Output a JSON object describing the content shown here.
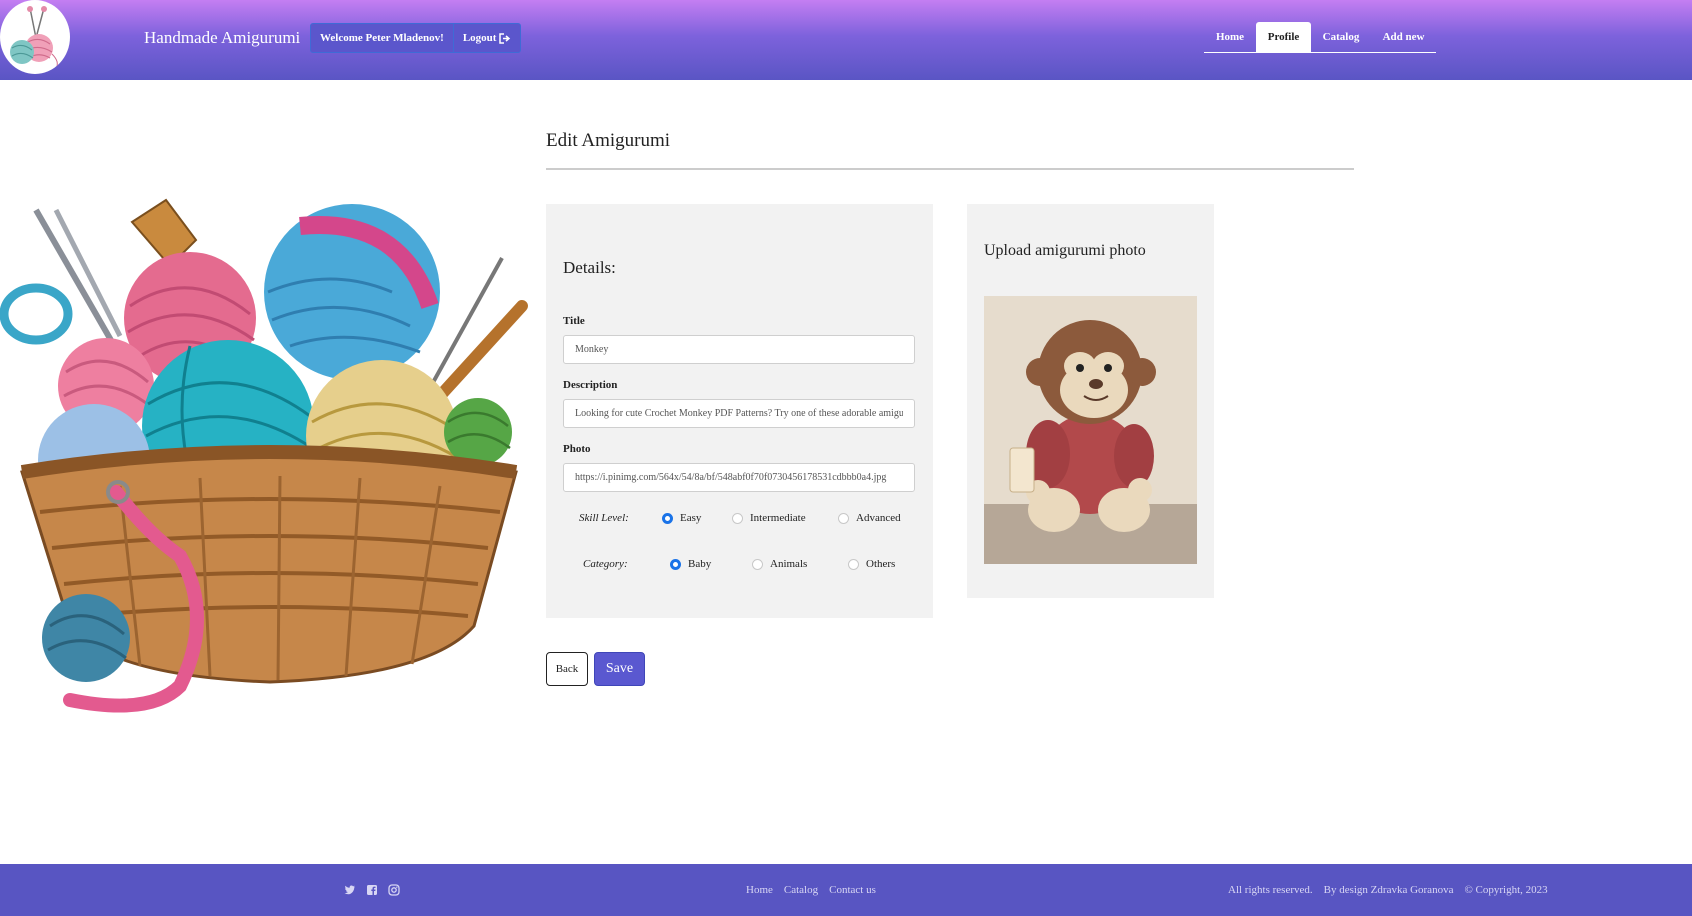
{
  "header": {
    "brand": "Handmade Amigurumi",
    "welcome": "Welcome Peter Mladenov!",
    "logout": "Logout",
    "nav": [
      "Home",
      "Profile",
      "Catalog",
      "Add new"
    ],
    "active_nav": "Profile",
    "gradient_top": "#c47ef2",
    "gradient_bottom": "#5a55c4"
  },
  "form": {
    "page_title": "Edit Amigurumi",
    "details_heading": "Details:",
    "title_label": "Title",
    "title_value": "Monkey",
    "description_label": "Description",
    "description_value": "Looking for cute Crochet Monkey PDF Patterns? Try one of these adorable amigurumi monkey patterns!",
    "photo_label": "Photo",
    "photo_value": "https://i.pinimg.com/564x/54/8a/bf/548abf0f70f0730456178531cdbbb0a4.jpg",
    "skill_label": "Skill Level:",
    "skill_options": [
      "Easy",
      "Intermediate",
      "Advanced"
    ],
    "skill_selected": "Easy",
    "category_label": "Category:",
    "category_options": [
      "Baby",
      "Animals",
      "Others"
    ],
    "category_selected": "Baby",
    "upload_heading": "Upload amigurumi photo",
    "back_label": "Back",
    "save_label": "Save",
    "accent": "#1a73e8",
    "save_color": "#5a58d0"
  },
  "footer": {
    "links": [
      "Home",
      "Catalog",
      "Contact us"
    ],
    "rights": "All rights reserved.",
    "design": "By design Zdravka Goranova",
    "copyright": "© Copyright, 2023",
    "social_icons": [
      "twitter-icon",
      "facebook-icon",
      "instagram-icon"
    ],
    "background": "#5855c2"
  }
}
